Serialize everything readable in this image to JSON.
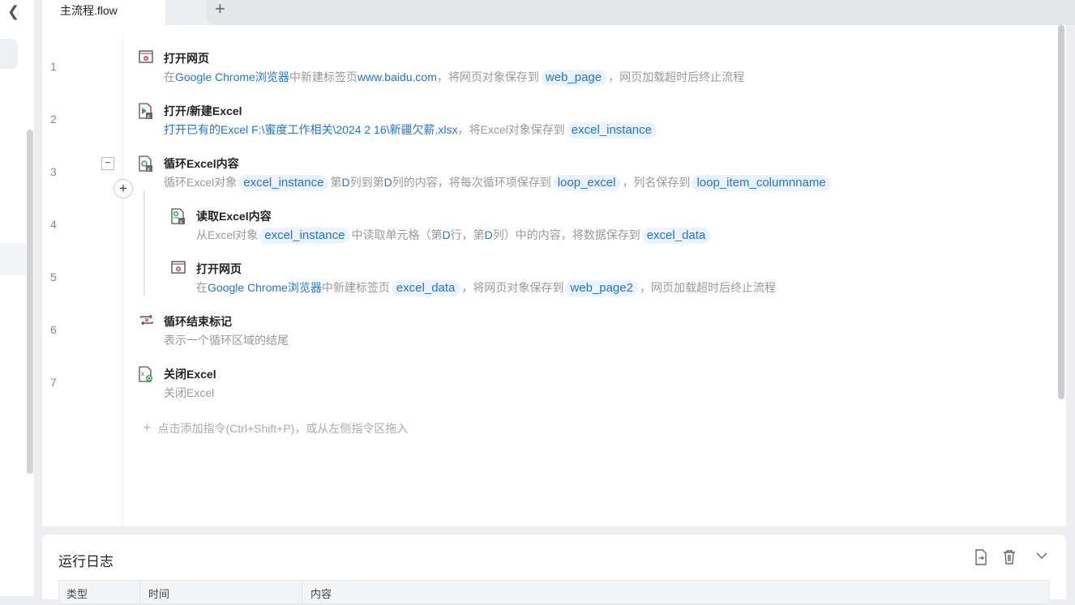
{
  "tab": {
    "name": "主流程.flow",
    "add": "+"
  },
  "rows": [
    {
      "ln": "1",
      "title": "打开网页",
      "icon": "browser-icon",
      "nested": false,
      "desc": [
        {
          "t": "在",
          "k": "text"
        },
        {
          "t": "Google Chrome浏览器",
          "k": "link"
        },
        {
          "t": "中新建标签页",
          "k": "text"
        },
        {
          "t": "www.baidu.com",
          "k": "link"
        },
        {
          "t": "，将网页对象保存到",
          "k": "text"
        },
        {
          "t": "web_page",
          "k": "var"
        },
        {
          "t": "，网页加载超时后终止流程",
          "k": "text"
        }
      ]
    },
    {
      "ln": "2",
      "title": "打开/新建Excel",
      "icon": "excel-open-icon",
      "nested": false,
      "desc": [
        {
          "t": "打开已有的Excel F:\\蜜度工作相关\\2024 2 16\\新疆欠薪.xlsx",
          "k": "link"
        },
        {
          "t": "，将Excel对象保存到",
          "k": "text"
        },
        {
          "t": "excel_instance",
          "k": "var"
        }
      ]
    },
    {
      "ln": "3",
      "title": "循环Excel内容",
      "icon": "excel-loop-icon",
      "nested": false,
      "desc": [
        {
          "t": "循环Excel对象",
          "k": "text"
        },
        {
          "t": "excel_instance",
          "k": "var"
        },
        {
          "t": "第",
          "k": "text"
        },
        {
          "t": "D",
          "k": "link"
        },
        {
          "t": "列到第",
          "k": "text"
        },
        {
          "t": "D",
          "k": "link"
        },
        {
          "t": "列的内容，将每次循环项保存到",
          "k": "text"
        },
        {
          "t": "loop_excel",
          "k": "var"
        },
        {
          "t": "，列名保存到",
          "k": "text"
        },
        {
          "t": "loop_item_columnname",
          "k": "var"
        }
      ]
    },
    {
      "ln": "4",
      "title": "读取Excel内容",
      "icon": "excel-read-icon",
      "nested": true,
      "desc": [
        {
          "t": "从Excel对象",
          "k": "text"
        },
        {
          "t": "excel_instance",
          "k": "var"
        },
        {
          "t": "中读取单元格（第",
          "k": "text"
        },
        {
          "t": "D",
          "k": "link"
        },
        {
          "t": "行，第",
          "k": "text"
        },
        {
          "t": "D",
          "k": "link"
        },
        {
          "t": "列）中的内容，将数据保存到",
          "k": "text"
        },
        {
          "t": "excel_data",
          "k": "var"
        }
      ]
    },
    {
      "ln": "5",
      "title": "打开网页",
      "icon": "browser-icon",
      "nested": true,
      "desc": [
        {
          "t": "在",
          "k": "text"
        },
        {
          "t": "Google Chrome浏览器",
          "k": "link"
        },
        {
          "t": "中新建标签页",
          "k": "text"
        },
        {
          "t": "excel_data",
          "k": "var"
        },
        {
          "t": "，将网页对象保存到",
          "k": "text"
        },
        {
          "t": "web_page2",
          "k": "var"
        },
        {
          "t": "，网页加载超时后终止流程",
          "k": "text"
        }
      ]
    },
    {
      "ln": "6",
      "title": "循环结束标记",
      "icon": "loop-end-icon",
      "nested": false,
      "desc": [
        {
          "t": "表示一个循环区域的结尾",
          "k": "text"
        }
      ]
    },
    {
      "ln": "7",
      "title": "关闭Excel",
      "icon": "excel-close-icon",
      "nested": false,
      "desc": [
        {
          "t": "关闭Excel",
          "k": "text"
        }
      ]
    }
  ],
  "add_command": {
    "plus": "+",
    "text": "点击添加指令(Ctrl+Shift+P)，或从左侧指令区拖入"
  },
  "log": {
    "title": "运行日志",
    "columns": [
      "类型",
      "时间",
      "内容"
    ]
  },
  "colors": {
    "link": "#1f74d6",
    "var_bg": "#eaf3fe"
  }
}
